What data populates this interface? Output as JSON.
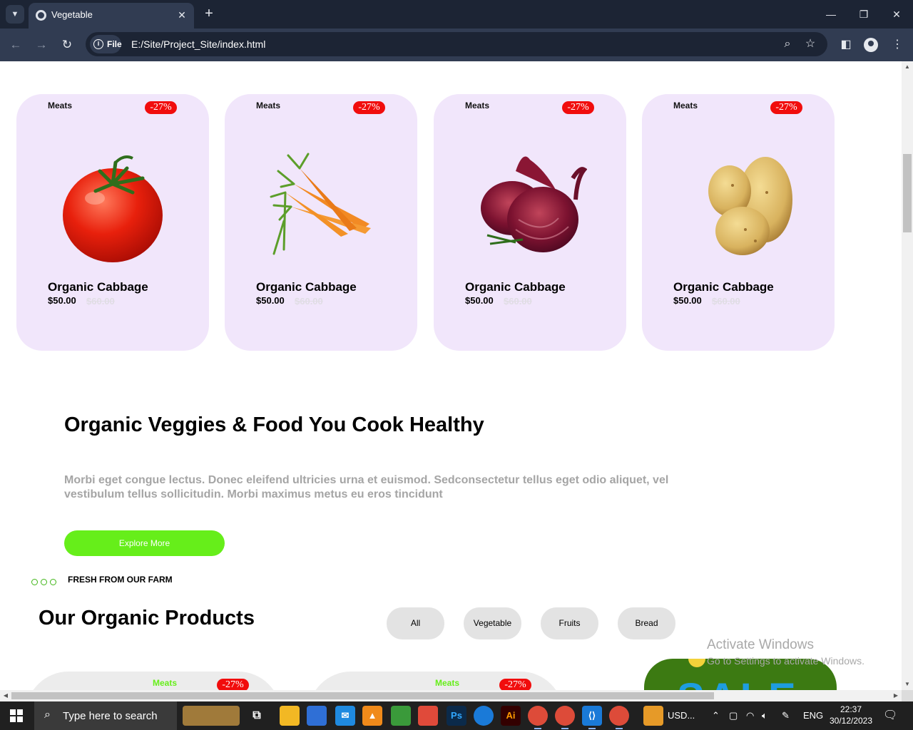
{
  "browser": {
    "tab_title": "Vegetable",
    "site_chip": "File",
    "url": "E:/Site/Project_Site/index.html"
  },
  "cards": [
    {
      "category": "Meats",
      "badge": "-27%",
      "name": "Organic Cabbage",
      "price": "$50.00",
      "old_price": "$60.00",
      "image": "tomato"
    },
    {
      "category": "Meats",
      "badge": "-27%",
      "name": "Organic Cabbage",
      "price": "$50.00",
      "old_price": "$60.00",
      "image": "carrots"
    },
    {
      "category": "Meats",
      "badge": "-27%",
      "name": "Organic Cabbage",
      "price": "$50.00",
      "old_price": "$60.00",
      "image": "red-onion"
    },
    {
      "category": "Meats",
      "badge": "-27%",
      "name": "Organic Cabbage",
      "price": "$50.00",
      "old_price": "$60.00",
      "image": "potatoes"
    }
  ],
  "hero": {
    "headline": "Organic Veggies & Food You Cook Healthy",
    "description": "Morbi eget congue lectus. Donec eleifend ultricies urna et euismod. Sedconsectetur tellus eget odio aliquet, vel vestibulum tellus sollicitudin. Morbi maximus metus eu eros tincidunt",
    "cta": "Explore More"
  },
  "products": {
    "eyebrow": "FRESH FROM OUR FARM",
    "title": "Our Organic Products",
    "filters": [
      "All",
      "Vegetable",
      "Fruits",
      "Bread"
    ],
    "cards": [
      {
        "category": "Meats",
        "badge": "-27%"
      },
      {
        "category": "Meats",
        "badge": "-27%"
      }
    ]
  },
  "watermark": {
    "line1": "Activate Windows",
    "line2": "Go to Settings to activate Windows."
  },
  "taskbar": {
    "search_placeholder": "Type here to search",
    "usd_label": "USD...",
    "language": "ENG",
    "time": "22:37",
    "date": "30/12/2023"
  },
  "colors": {
    "card_bg": "#f1e6fb",
    "badge": "#f10d0d",
    "accent_green": "#66ee1a",
    "browser_dark": "#1c2434"
  }
}
